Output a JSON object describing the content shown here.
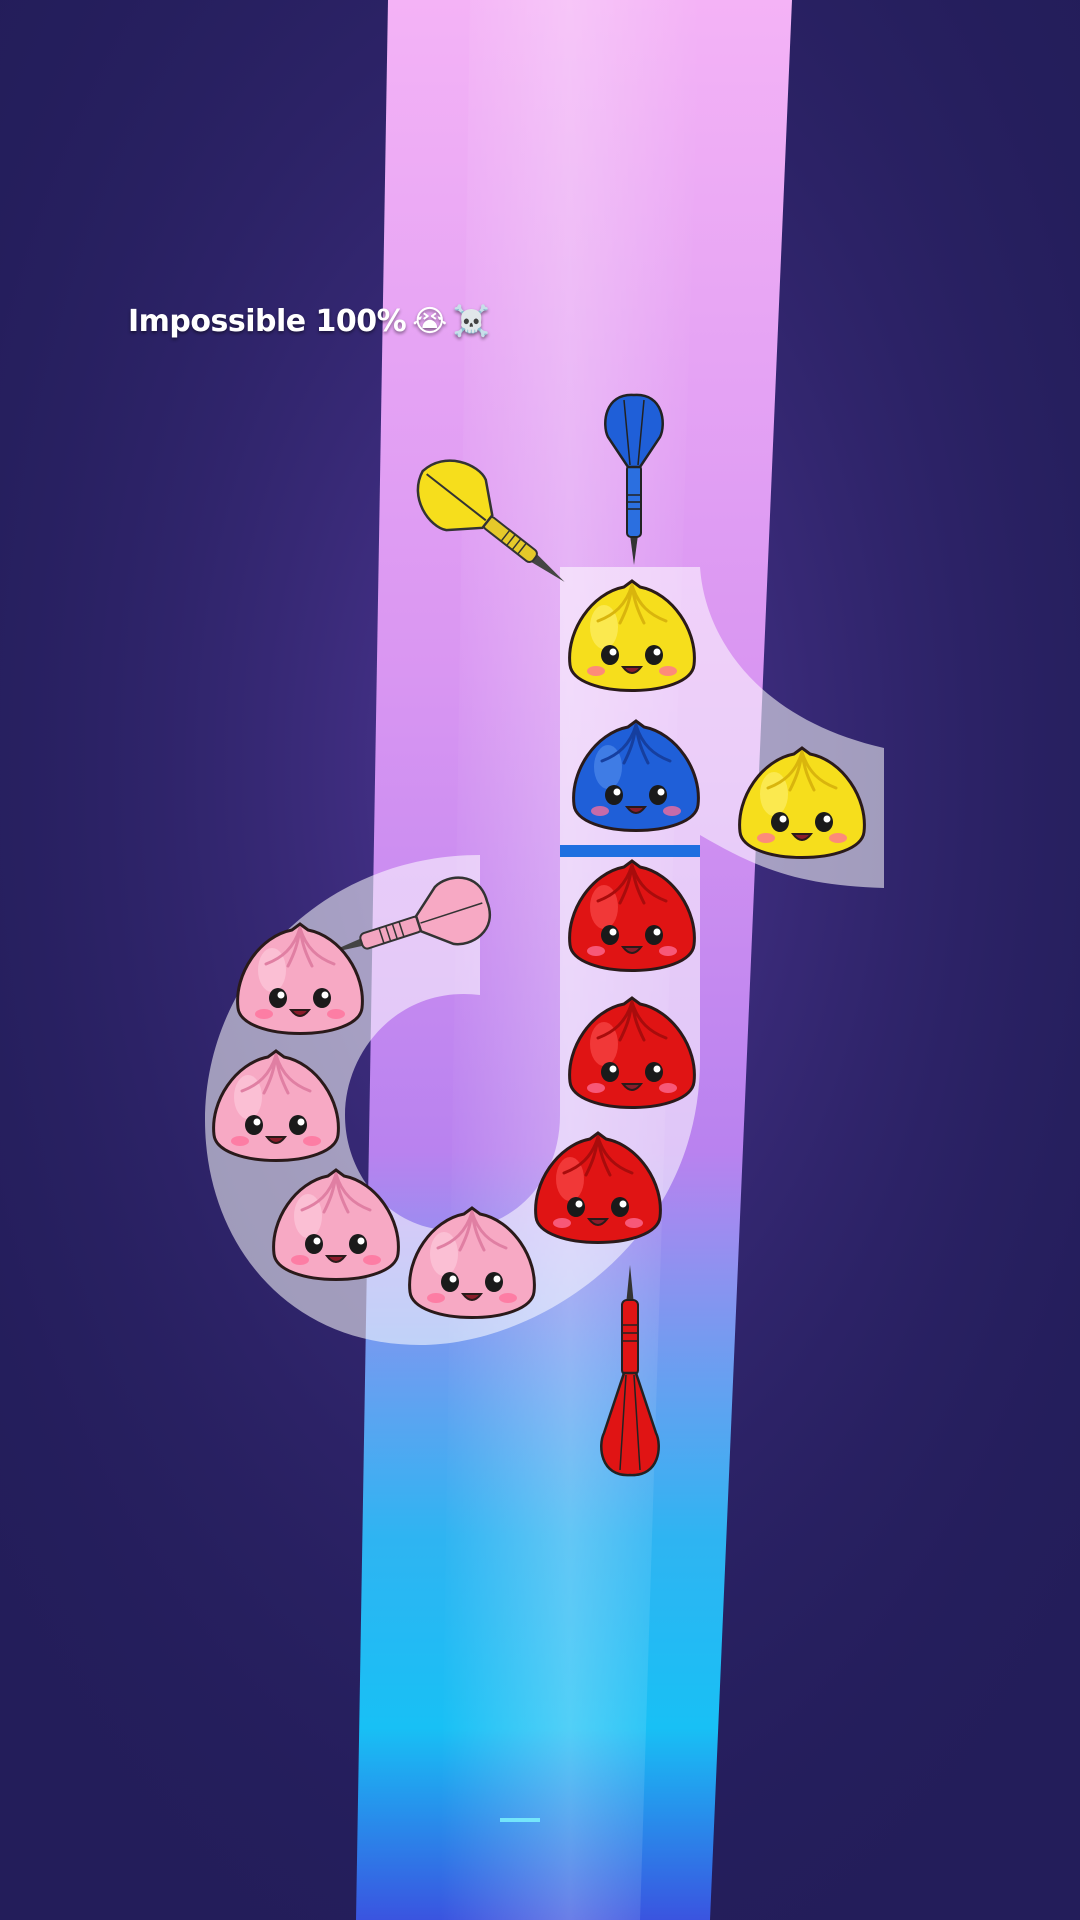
{
  "caption": {
    "text": "Impossible 100%",
    "emoji_1": "😭",
    "emoji_2": "☠️"
  },
  "colors": {
    "background": "#241f5c",
    "beam_top": "#f3b0f5",
    "beam_mid": "#cf8af0",
    "beam_bottom": "#14b6f0",
    "logo_overlay": "#ffffff",
    "yellow": "#f6de1c",
    "blue": "#1f5fd8",
    "red": "#e01414",
    "pink": "#f7a9c4",
    "divider": "#1f6fe0"
  },
  "game": {
    "darts": [
      {
        "id": "dart-yellow",
        "color": "yellow",
        "direction": "down-right"
      },
      {
        "id": "dart-blue",
        "color": "blue",
        "direction": "down"
      },
      {
        "id": "dart-pink",
        "color": "pink",
        "direction": "down-left"
      },
      {
        "id": "dart-red",
        "color": "red",
        "direction": "up"
      }
    ],
    "dumplings": [
      {
        "color": "yellow"
      },
      {
        "color": "blue"
      },
      {
        "color": "yellow"
      },
      {
        "color": "red"
      },
      {
        "color": "red"
      },
      {
        "color": "red"
      },
      {
        "color": "pink"
      },
      {
        "color": "pink"
      },
      {
        "color": "pink"
      },
      {
        "color": "pink"
      }
    ]
  }
}
